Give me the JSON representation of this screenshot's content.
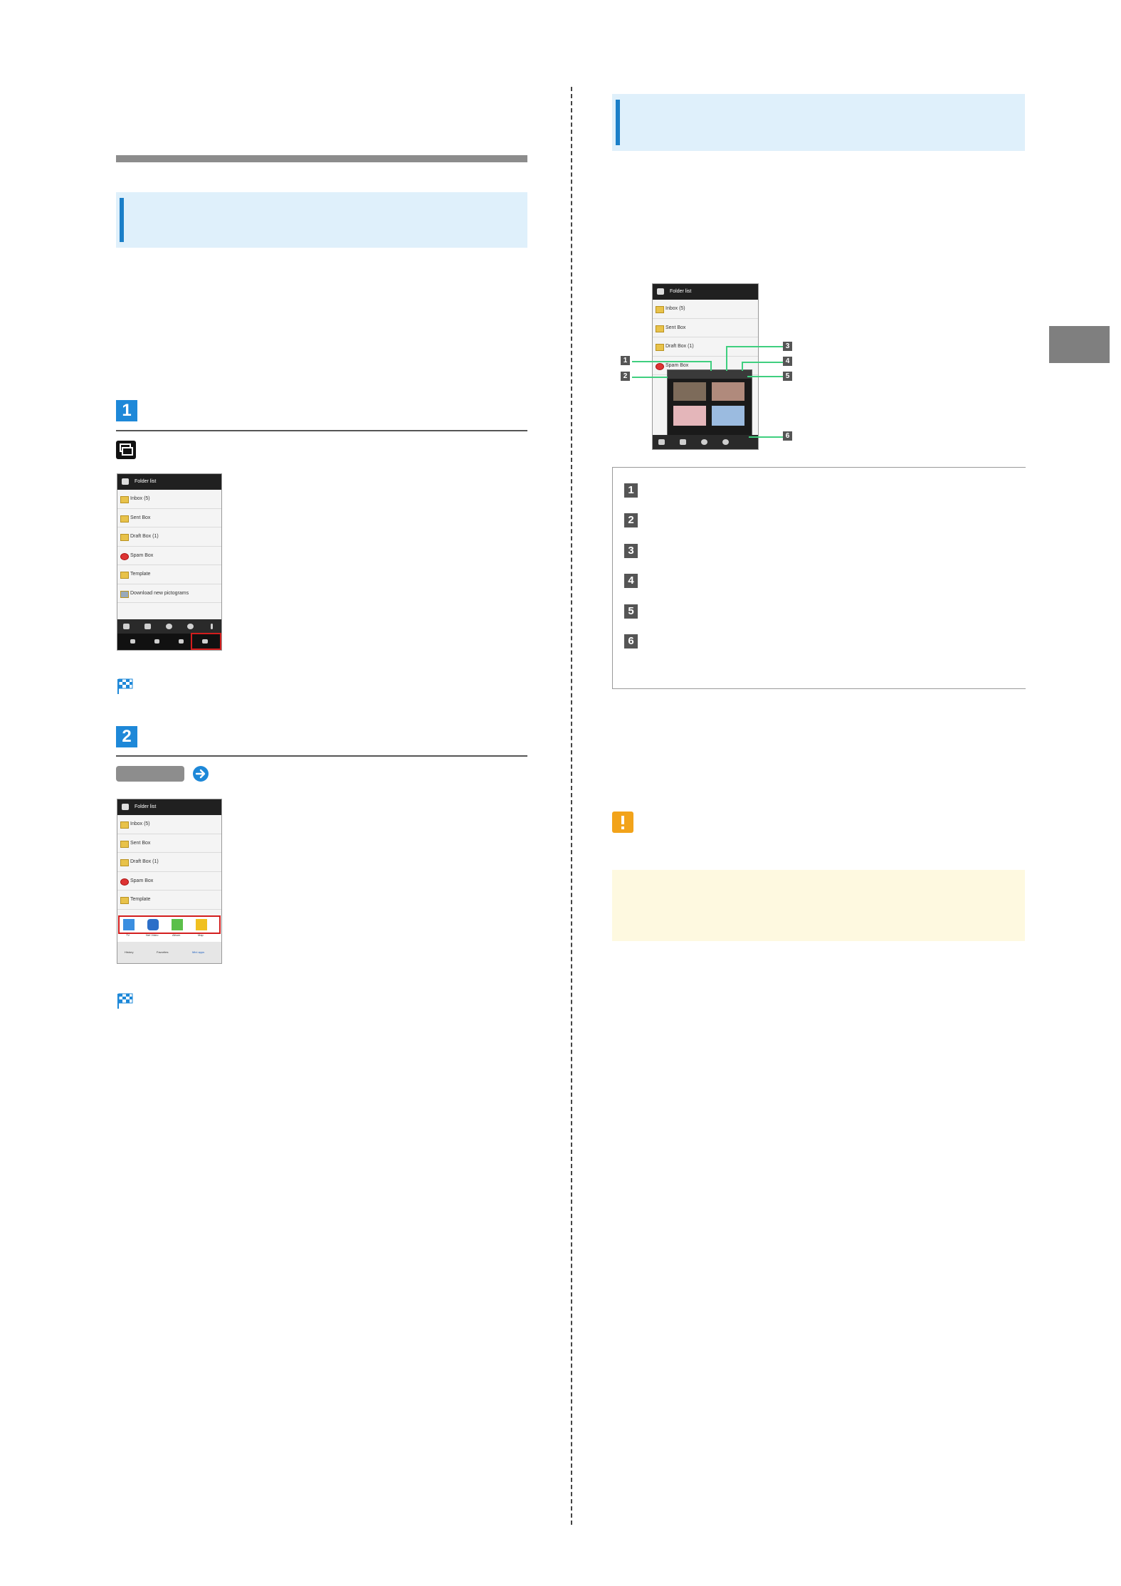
{
  "phone": {
    "title": "Folder list",
    "folders": [
      "Inbox (5)",
      "Sent Box",
      "Draft Box (1)",
      "Spam Box",
      "Template",
      "Download new pictograms"
    ],
    "app_row": [
      "TV",
      "Net Video",
      "Album",
      "Map"
    ],
    "tabs": [
      "History",
      "Favorites",
      "Mini apps"
    ]
  },
  "callouts": [
    "1",
    "2",
    "3",
    "4",
    "5",
    "6"
  ],
  "steps": [
    "1",
    "2"
  ],
  "colors": {
    "banner_bg": "#dff0fb",
    "banner_accent": "#1b7fc8",
    "step_blue": "#1e88d8",
    "caution_bg": "#fef9e0",
    "caution_icon": "#f2a31a",
    "highlight_red": "#d31d1d",
    "callout_line": "#3fcf7f"
  },
  "icons": [
    "multi-window-icon",
    "arrow-right-circle-icon",
    "checkered-flag-icon",
    "caution-icon"
  ]
}
